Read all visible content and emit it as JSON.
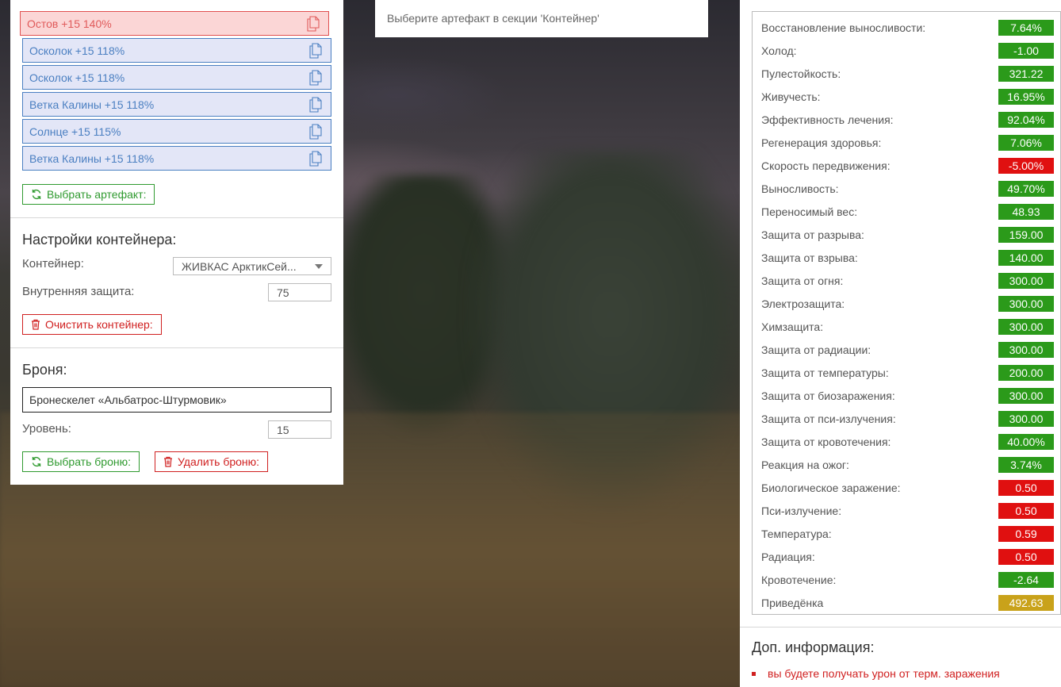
{
  "artifacts": [
    {
      "label": "Остов +15 140%",
      "active": true
    },
    {
      "label": "Осколок +15 118%",
      "active": false
    },
    {
      "label": "Осколок +15 118%",
      "active": false
    },
    {
      "label": "Ветка Калины +15 118%",
      "active": false
    },
    {
      "label": "Солнце +15 115%",
      "active": false
    },
    {
      "label": "Ветка Калины +15 118%",
      "active": false
    }
  ],
  "choose_artifact_button": "Выбрать артефакт:",
  "container": {
    "title": "Настройки контейнера:",
    "container_label": "Контейнер:",
    "container_value": "ЖИВКАС АрктикСей...",
    "protection_label": "Внутренняя защита:",
    "protection_value": "75",
    "clear_button": "Очистить контейнер:"
  },
  "armor": {
    "title": "Броня:",
    "armor_value": "Бронескелет «Альбатрос-Штурмовик»",
    "level_label": "Уровень:",
    "level_value": "15",
    "choose_button": "Выбрать броню:",
    "delete_button": "Удалить броню:"
  },
  "middle": {
    "hint": "Выберите артефакт в секции 'Контейнер'"
  },
  "stats": [
    {
      "name": "Восстановление выносливости:",
      "value": "7.64%",
      "color": "green"
    },
    {
      "name": "Холод:",
      "value": "-1.00",
      "color": "green"
    },
    {
      "name": "Пулестойкость:",
      "value": "321.22",
      "color": "green"
    },
    {
      "name": "Живучесть:",
      "value": "16.95%",
      "color": "green"
    },
    {
      "name": "Эффективность лечения:",
      "value": "92.04%",
      "color": "green"
    },
    {
      "name": "Регенерация здоровья:",
      "value": "7.06%",
      "color": "green"
    },
    {
      "name": "Скорость передвижения:",
      "value": "-5.00%",
      "color": "red"
    },
    {
      "name": "Выносливость:",
      "value": "49.70%",
      "color": "green"
    },
    {
      "name": "Переносимый вес:",
      "value": "48.93",
      "color": "green"
    },
    {
      "name": "Защита от разрыва:",
      "value": "159.00",
      "color": "green"
    },
    {
      "name": "Защита от взрыва:",
      "value": "140.00",
      "color": "green"
    },
    {
      "name": "Защита от огня:",
      "value": "300.00",
      "color": "green"
    },
    {
      "name": "Электрозащита:",
      "value": "300.00",
      "color": "green"
    },
    {
      "name": "Химзащита:",
      "value": "300.00",
      "color": "green"
    },
    {
      "name": "Защита от радиации:",
      "value": "300.00",
      "color": "green"
    },
    {
      "name": "Защита от температуры:",
      "value": "200.00",
      "color": "green"
    },
    {
      "name": "Защита от биозаражения:",
      "value": "300.00",
      "color": "green"
    },
    {
      "name": "Защита от пси-излучения:",
      "value": "300.00",
      "color": "green"
    },
    {
      "name": "Защита от кровотечения:",
      "value": "40.00%",
      "color": "green"
    },
    {
      "name": "Реакция на ожог:",
      "value": "3.74%",
      "color": "green"
    },
    {
      "name": "Биологическое заражение:",
      "value": "0.50",
      "color": "red"
    },
    {
      "name": "Пси-излучение:",
      "value": "0.50",
      "color": "red"
    },
    {
      "name": "Температура:",
      "value": "0.59",
      "color": "red"
    },
    {
      "name": "Радиация:",
      "value": "0.50",
      "color": "red"
    },
    {
      "name": "Кровотечение:",
      "value": "-2.64",
      "color": "green"
    },
    {
      "name": "Приведёнка",
      "value": "492.63",
      "color": "gold"
    }
  ],
  "info": {
    "title": "Доп. информация:",
    "items": [
      "вы будете получать урон от терм. заражения"
    ]
  },
  "colors": {
    "green": "#2b9a1a",
    "red": "#e01010",
    "gold": "#c9a21a",
    "artifact_blue": "#4a7fc1",
    "artifact_red": "#e05a5a"
  }
}
